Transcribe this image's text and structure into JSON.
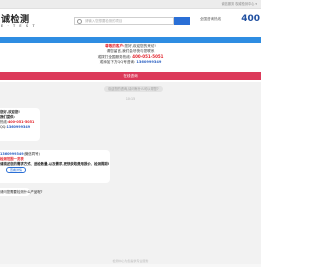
{
  "topbar": {
    "right_text": "诚信服务 权威检测中心 ▾"
  },
  "header": {
    "logo": "诚检测",
    "logo_sub": "E · T E S T",
    "search_placeholder": "请输入您想要检测的项目",
    "hotline_label": "全国咨询热线",
    "hotline_number": "400"
  },
  "notice": {
    "line1_red": "尊敬的客户:",
    "line1_rest": "您好,欢迎您的来访!",
    "line2": "请您留言,我们会尽快与您联系",
    "line3_prefix": "或拨打全国服务热线:",
    "phone": "400-051-5051",
    "line4_prefix": "或添加下方QQ号咨询:",
    "qq": "1360999349"
  },
  "consult_button": "在线咨询",
  "chat": {
    "system_message": "欢迎您的咨询,请问有什么可以帮您?",
    "time": "10:15",
    "bubble1": {
      "line1": "您好,欢迎您!",
      "line2": "我们提供:",
      "line3_prefix": "热线:",
      "line3_phone": "400-051-5051",
      "line4_prefix": "QQ:",
      "line4_qq": "1360999349"
    },
    "bubble2": {
      "line1_blue": "1360999349",
      "line1_rest": "(微信同号)",
      "line2_red": "检测范围一览表",
      "line3": "请描述您的需求方式、送检数量,以及需求,更快获取费用报价、检测周期!",
      "chip": "查看详情"
    },
    "bubble3": "请问您需要检测什么产品呢?"
  },
  "footer": {
    "text": "检测中心为您提供专业服务"
  }
}
